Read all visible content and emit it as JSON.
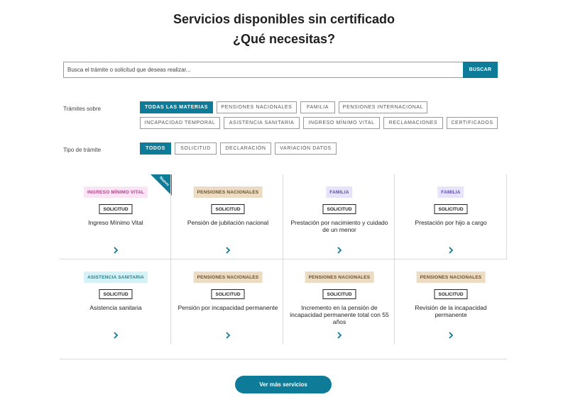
{
  "header": {
    "title_line1": "Servicios disponibles sin certificado",
    "title_line2": "¿Qué necesitas?"
  },
  "search": {
    "placeholder": "Busca el trámite o solicitud que deseas realizar...",
    "value": "",
    "button_label": "BUSCAR"
  },
  "filters": {
    "materias_label": "Trámites sobre",
    "materias": [
      {
        "label": "Todas las materias",
        "active": true
      },
      {
        "label": "Pensiones nacionales",
        "active": false
      },
      {
        "label": "Familia",
        "active": false
      },
      {
        "label": "Pensiones internacional",
        "active": false
      },
      {
        "label": "Incapacidad temporal",
        "active": false
      },
      {
        "label": "Asistencia sanitaria",
        "active": false
      },
      {
        "label": "Ingreso mínimo vital",
        "active": false
      },
      {
        "label": "Reclamaciones",
        "active": false
      },
      {
        "label": "Certificados",
        "active": false
      }
    ],
    "tipo_label": "Tipo de trámite",
    "tipos": [
      {
        "label": "Todos",
        "active": true
      },
      {
        "label": "Solicitud",
        "active": false
      },
      {
        "label": "Declaración",
        "active": false
      },
      {
        "label": "Variación datos",
        "active": false
      }
    ]
  },
  "colors": {
    "accent": "#0e7c99",
    "imv_bg": "#fbe4f3",
    "imv_fg": "#b43c8c",
    "pensiones_bg": "#ecdcc3",
    "pensiones_fg": "#6a4e2c",
    "familia_bg": "#e6e3fb",
    "familia_fg": "#5a4fb2",
    "asistencia_bg": "#d5f2f7",
    "asistencia_fg": "#2a7c8c"
  },
  "cards": [
    {
      "category": "INGRESO MÍNIMO VITAL",
      "cat_key": "imv",
      "type": "SOLICITUD",
      "name": "Ingreso Mínimo Vital",
      "ribbon": "Nuevo",
      "arrow_icon": "chevron-right-icon"
    },
    {
      "category": "PENSIONES NACIONALES",
      "cat_key": "pensiones",
      "type": "SOLICITUD",
      "name": "Pensión de jubilación nacional",
      "arrow_icon": "chevron-right-icon"
    },
    {
      "category": "FAMILIA",
      "cat_key": "familia",
      "type": "SOLICITUD",
      "name": "Prestación por nacimiento y cuidado de un menor",
      "arrow_icon": "chevron-right-icon"
    },
    {
      "category": "FAMILIA",
      "cat_key": "familia",
      "type": "SOLICITUD",
      "name": "Prestación por hijo a cargo",
      "arrow_icon": "chevron-right-icon"
    },
    {
      "category": "ASISTENCIA SANITARIA",
      "cat_key": "asistencia",
      "type": "SOLICITUD",
      "name": "Asistencia sanitaria",
      "arrow_icon": "chevron-right-icon"
    },
    {
      "category": "PENSIONES NACIONALES",
      "cat_key": "pensiones",
      "type": "SOLICITUD",
      "name": "Pensión por incapacidad permanente",
      "arrow_icon": "chevron-right-icon"
    },
    {
      "category": "PENSIONES NACIONALES",
      "cat_key": "pensiones",
      "type": "SOLICITUD",
      "name": "Incremento en la pensión de incapacidad permanente total con 55 años",
      "arrow_icon": "chevron-right-icon"
    },
    {
      "category": "PENSIONES NACIONALES",
      "cat_key": "pensiones",
      "type": "SOLICITUD",
      "name": "Revisión de la incapacidad permanente",
      "arrow_icon": "chevron-right-icon"
    }
  ],
  "more_button": "Ver más servicios"
}
